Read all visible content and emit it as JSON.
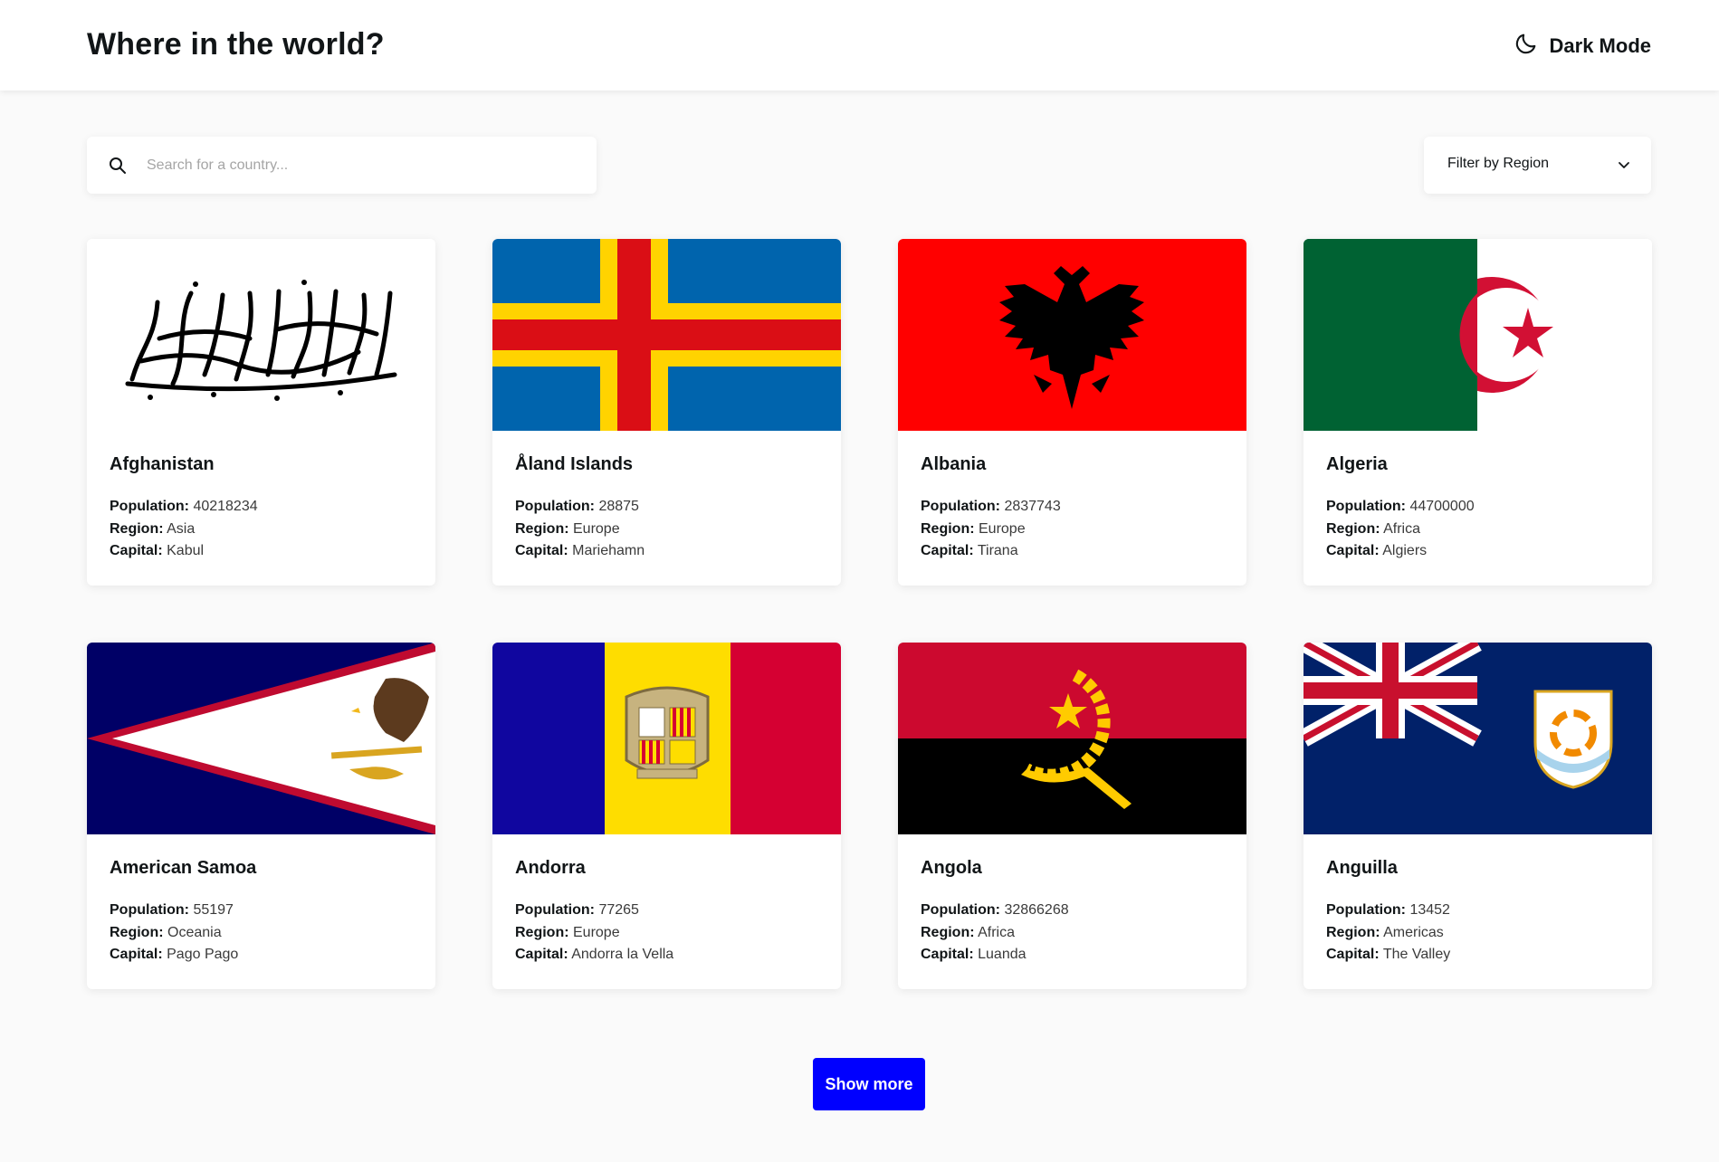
{
  "header": {
    "title": "Where in the world?",
    "dark_mode_label": "Dark Mode",
    "dark_mode_icon": "moon-icon"
  },
  "search": {
    "placeholder": "Search for a country...",
    "value": "",
    "icon": "search-icon"
  },
  "filter": {
    "label": "Filter by Region",
    "icon": "chevron-down-icon"
  },
  "labels": {
    "population": "Population:",
    "region": "Region:",
    "capital": "Capital:"
  },
  "countries": [
    {
      "name": "Afghanistan",
      "population": "40218234",
      "region": "Asia",
      "capital": "Kabul",
      "flag": "afghanistan-flag"
    },
    {
      "name": "Åland Islands",
      "population": "28875",
      "region": "Europe",
      "capital": "Mariehamn",
      "flag": "aland-islands-flag"
    },
    {
      "name": "Albania",
      "population": "2837743",
      "region": "Europe",
      "capital": "Tirana",
      "flag": "albania-flag"
    },
    {
      "name": "Algeria",
      "population": "44700000",
      "region": "Africa",
      "capital": "Algiers",
      "flag": "algeria-flag"
    },
    {
      "name": "American Samoa",
      "population": "55197",
      "region": "Oceania",
      "capital": "Pago Pago",
      "flag": "american-samoa-flag"
    },
    {
      "name": "Andorra",
      "population": "77265",
      "region": "Europe",
      "capital": "Andorra la Vella",
      "flag": "andorra-flag"
    },
    {
      "name": "Angola",
      "population": "32866268",
      "region": "Africa",
      "capital": "Luanda",
      "flag": "angola-flag"
    },
    {
      "name": "Anguilla",
      "population": "13452",
      "region": "Americas",
      "capital": "The Valley",
      "flag": "anguilla-flag"
    }
  ],
  "show_more_label": "Show more",
  "colors": {
    "accent": "#0000ff",
    "background": "#fafafa",
    "card": "#ffffff",
    "text": "#111517"
  }
}
